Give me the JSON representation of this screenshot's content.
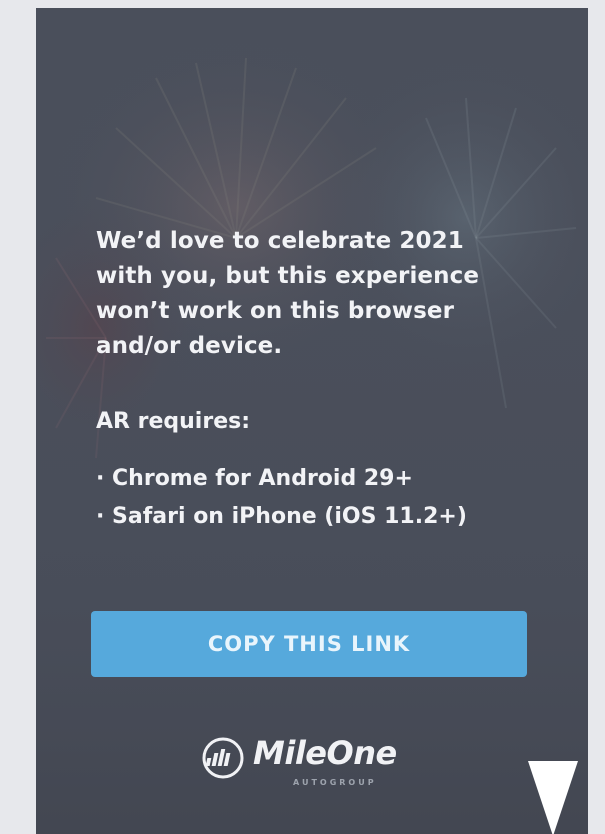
{
  "message": {
    "text": "We’d love to celebrate 2021 with you, but this experience won’t work on this browser and/or device."
  },
  "requirements": {
    "title": "AR requires:",
    "items": [
      "Chrome for Android 29+",
      "Safari on iPhone (iOS 11.2+)"
    ]
  },
  "copy_button": {
    "label": "COPY THIS LINK"
  },
  "logo": {
    "name": "MileOne",
    "subtitle": "AUTOGROUP"
  },
  "icons": {
    "logo_mark": "mileone-logo-icon",
    "scroll": "scroll-down-arrow-icon"
  },
  "colors": {
    "card_background": "#4a4f5b",
    "button": "#56a9dc",
    "text": "#f2f3f6"
  }
}
